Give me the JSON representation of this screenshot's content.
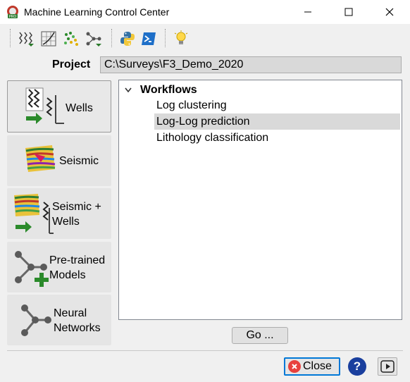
{
  "window": {
    "title": "Machine Learning Control Center"
  },
  "toolbar": {
    "icons": [
      "well-logs-icon",
      "crossplot-icon",
      "scatter-icon",
      "network-icon",
      "python-icon",
      "terminal-icon",
      "lightbulb-icon"
    ]
  },
  "project": {
    "label": "Project",
    "value": "C:\\Surveys\\F3_Demo_2020"
  },
  "sidebar": {
    "buttons": [
      {
        "label_1": "Wells",
        "label_2": "",
        "active": true
      },
      {
        "label_1": "Seismic",
        "label_2": "",
        "active": false
      },
      {
        "label_1": "Seismic +",
        "label_2": "Wells",
        "active": false
      },
      {
        "label_1": "Pre-trained",
        "label_2": "Models",
        "active": false
      },
      {
        "label_1": "Neural",
        "label_2": "Networks",
        "active": false
      }
    ]
  },
  "tree": {
    "root_label": "Workflows",
    "items": [
      {
        "label": "Log clustering",
        "selected": false
      },
      {
        "label": "Log-Log prediction",
        "selected": true
      },
      {
        "label": "Lithology classification",
        "selected": false
      }
    ]
  },
  "actions": {
    "go_label": "Go ...",
    "close_label": "Close",
    "help_label": "?"
  },
  "colors": {
    "selection": "#d9d9d9",
    "focus_border": "#0078d7",
    "help_blue": "#1a3f9e",
    "close_red": "#e8413e"
  }
}
